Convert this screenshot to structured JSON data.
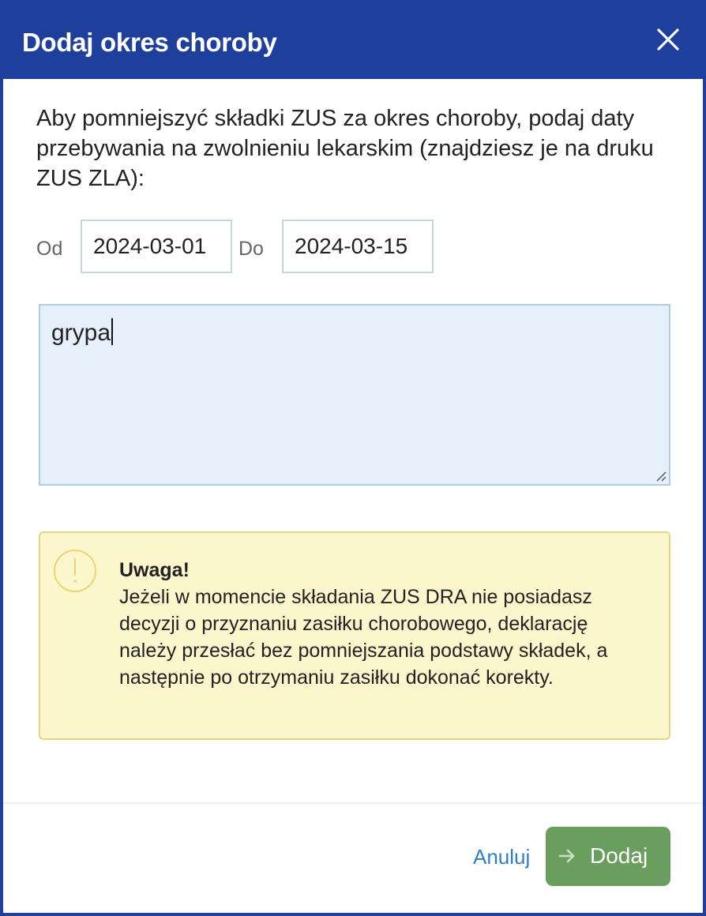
{
  "dialog": {
    "title": "Dodaj okres choroby",
    "close_icon": "close-icon"
  },
  "intro": {
    "text": "Aby pomniejszyć składki ZUS za okres choroby, podaj daty przebywania na zwolnieniu lekarskim (znajdziesz je na druku ZUS ZLA):"
  },
  "dates": {
    "from_label": "Od",
    "from_value": "2024-03-01",
    "to_label": "Do",
    "to_value": "2024-03-15"
  },
  "note": {
    "value": "grypa"
  },
  "warning": {
    "icon": "exclamation-circle-icon",
    "title": "Uwaga!",
    "body": "Jeżeli w momencie składania ZUS DRA nie posiadasz decyzji o przyznaniu zasiłku chorobowego, deklarację należy przesłać bez pomniejszania podstawy składek, a następnie po otrzymaniu zasiłku dokonać korekty."
  },
  "footer": {
    "cancel_label": "Anuluj",
    "add_label": "Dodaj",
    "add_icon": "arrow-right-icon"
  },
  "colors": {
    "header": "#1f3f9c",
    "add_button": "#6a9e5f",
    "link": "#2f7fc8",
    "warning_bg": "#fcf6cc",
    "textarea_bg": "#e6f0fb"
  }
}
